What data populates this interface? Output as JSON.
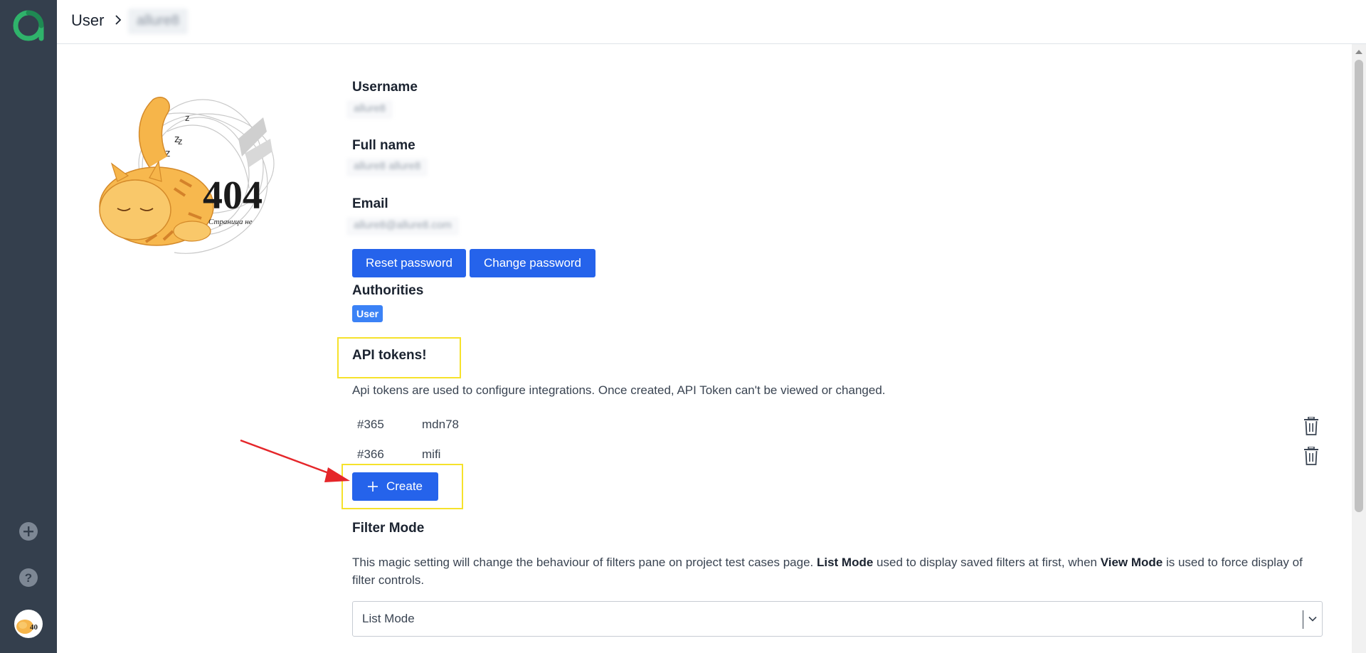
{
  "breadcrumb": {
    "root": "User",
    "current": "allure8"
  },
  "profile": {
    "username_label": "Username",
    "username_value": "allure8",
    "fullname_label": "Full name",
    "fullname_value": "allure8 allure8",
    "email_label": "Email",
    "email_value": "allure8@allure8.com",
    "reset_password_label": "Reset password",
    "change_password_label": "Change password",
    "authorities_label": "Authorities",
    "authority_badge": "User"
  },
  "api_tokens": {
    "title": "API tokens!",
    "description": "Api tokens are used to configure integrations. Once created, API Token can't be viewed or changed.",
    "tokens": [
      {
        "id": "#365",
        "name": "mdn78"
      },
      {
        "id": "#366",
        "name": "mifi"
      }
    ],
    "create_label": "Create"
  },
  "filter_mode": {
    "title": "Filter Mode",
    "desc_part1": "This magic setting will change the behaviour of filters pane on project test cases page. ",
    "desc_bold1": "List Mode",
    "desc_part2": " used to display saved filters at first, when ",
    "desc_bold2": "View Mode",
    "desc_part3": " is used to force display of filter controls.",
    "selected": "List Mode"
  },
  "icons": {
    "logo": "allure-logo",
    "add": "plus-circle-icon",
    "help": "question-circle-icon",
    "delete": "trash-icon"
  },
  "colors": {
    "sidebar": "#343f4d",
    "primary": "#2563eb",
    "badge": "#3b82f6",
    "annotation": "#f6e22b",
    "arrow": "#e5262a"
  }
}
